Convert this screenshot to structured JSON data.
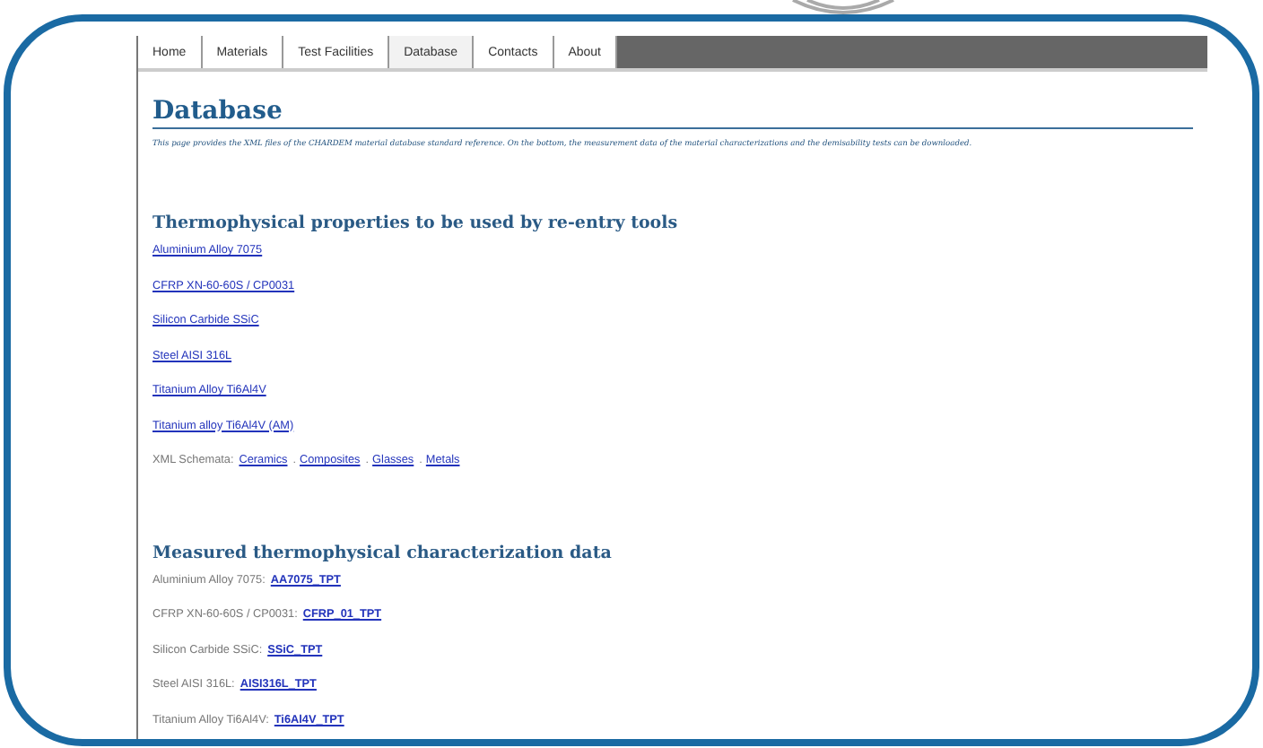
{
  "nav": {
    "tabs": [
      {
        "label": "Home",
        "selected": false
      },
      {
        "label": "Materials",
        "selected": false
      },
      {
        "label": "Test Facilities",
        "selected": false
      },
      {
        "label": "Database",
        "selected": true
      },
      {
        "label": "Contacts",
        "selected": false
      },
      {
        "label": "About",
        "selected": false
      }
    ]
  },
  "page": {
    "title": "Database",
    "description": "This page provides the XML files of the CHARDEM material database standard reference. On the bottom, the measurement data of the material characterizations and the demisability tests can be downloaded.",
    "sections": [
      {
        "title": "Thermophysical properties to be used by re-entry tools",
        "items": [
          {
            "kind": "link",
            "link": "Aluminium Alloy 7075"
          },
          {
            "kind": "link",
            "link": "CFRP XN-60-60S / CP0031"
          },
          {
            "kind": "link",
            "link": "Silicon Carbide SSiC"
          },
          {
            "kind": "link",
            "link": "Steel AISI 316L"
          },
          {
            "kind": "link",
            "link": "Titanium Alloy Ti6Al4V"
          },
          {
            "kind": "link",
            "link": "Titanium alloy Ti6Al4V (AM)"
          },
          {
            "kind": "links",
            "label": "XML Schemata:",
            "separator": ".",
            "links": [
              "Ceramics",
              "Composites",
              "Glasses",
              "Metals"
            ]
          }
        ]
      },
      {
        "title": "Measured thermophysical characterization data",
        "items": [
          {
            "kind": "labeled",
            "label": "Aluminium Alloy 7075:",
            "link": "AA7075_TPT"
          },
          {
            "kind": "labeled",
            "label": "CFRP XN-60-60S / CP0031:",
            "link": "CFRP_01_TPT"
          },
          {
            "kind": "labeled",
            "label": "Silicon Carbide SSiC:",
            "link": "SSiC_TPT"
          },
          {
            "kind": "labeled",
            "label": "Steel AISI 316L:",
            "link": "AISI316L_TPT"
          },
          {
            "kind": "labeled",
            "label": "Titanium Alloy Ti6Al4V:",
            "link": "Ti6Al4V_TPT"
          }
        ]
      }
    ]
  }
}
